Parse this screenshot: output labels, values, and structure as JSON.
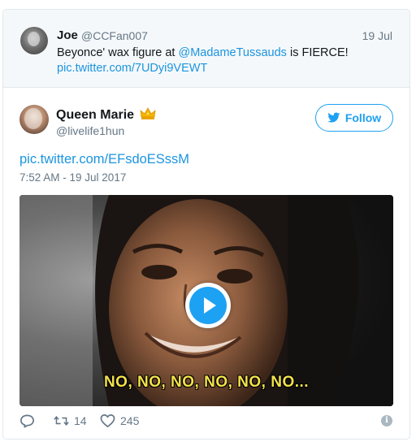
{
  "parent_tweet": {
    "name": "Joe",
    "handle": "@CCFan007",
    "date": "19 Jul",
    "text_parts": {
      "before": "Beyonce' wax figure at ",
      "mention": "@MadameTussauds",
      "after": " is FIERCE!"
    },
    "link": "pic.twitter.com/7UDyi9VEWT"
  },
  "tweet": {
    "name": "Queen Marie",
    "name_emoji": "crown-icon",
    "handle": "@livelife1hun",
    "follow_label": "Follow",
    "link": "pic.twitter.com/EFsdoESssM",
    "timestamp": "7:52 AM - 19 Jul 2017",
    "media_caption": "NO, NO, NO, NO, NO, NO...",
    "media_type": "gif-video",
    "retweet_count": "14",
    "like_count": "245"
  },
  "icons": {
    "reply": "reply-icon",
    "retweet": "retweet-icon",
    "like": "heart-icon",
    "info": "info-icon",
    "play": "play-icon",
    "follow": "bird-icon"
  },
  "colors": {
    "accent": "#1da1f2",
    "link": "#1b95e0",
    "muted": "#657786",
    "caption": "#f2e24a"
  }
}
